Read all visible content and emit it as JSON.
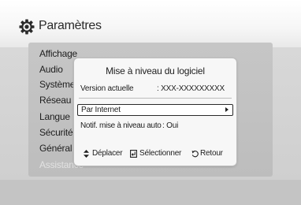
{
  "window": {
    "title": "Paramètres",
    "icon": "gear-icon"
  },
  "menu": {
    "items": [
      {
        "label": "Affichage",
        "enabled": true
      },
      {
        "label": "Audio",
        "enabled": true
      },
      {
        "label": "Système",
        "enabled": true
      },
      {
        "label": "Réseau",
        "enabled": true
      },
      {
        "label": "Langue",
        "enabled": true
      },
      {
        "label": "Sécurité",
        "enabled": true
      },
      {
        "label": "Général",
        "enabled": true
      },
      {
        "label": "Assistance",
        "enabled": false
      }
    ]
  },
  "dialog": {
    "title": "Mise à niveau du logiciel",
    "version_label": "Version actuelle",
    "version_value": ": XXX-XXXXXXXXX",
    "option_label": "Par Internet",
    "notif_label": "Notif. mise à niveau auto",
    "notif_value": ": Oui"
  },
  "hints": {
    "move_label": "Déplacer",
    "move_icon": "up-down-arrow-icon",
    "select_label": "Sélectionner",
    "select_icon": "enter-icon",
    "back_label": "Retour",
    "back_icon": "return-icon"
  }
}
